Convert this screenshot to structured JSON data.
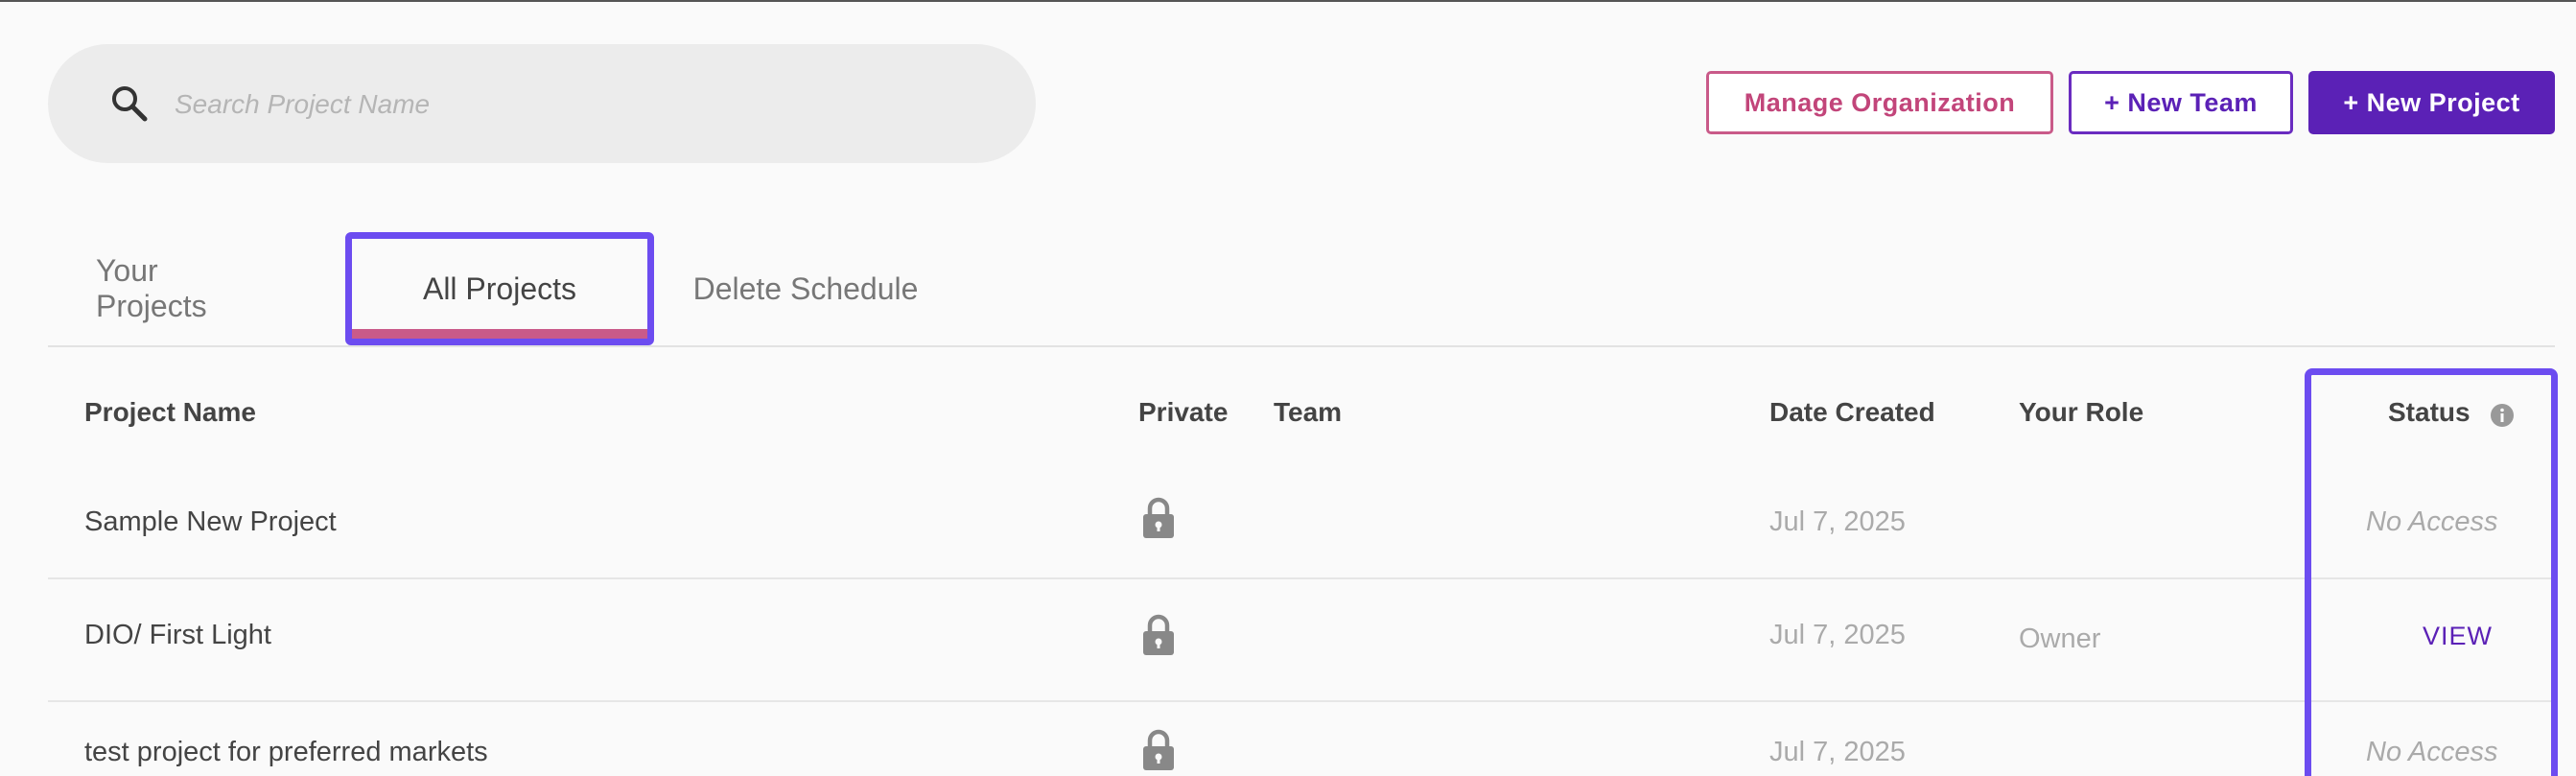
{
  "search": {
    "placeholder": "Search Project Name"
  },
  "toolbar": {
    "manage_label": "Manage Organization",
    "new_team_label": "+ New Team",
    "new_project_label": "+ New Project"
  },
  "tabs": [
    {
      "label": "Your Projects"
    },
    {
      "label": "All Projects"
    },
    {
      "label": "Delete Schedule"
    }
  ],
  "table": {
    "headers": {
      "name": "Project Name",
      "private": "Private",
      "team": "Team",
      "date": "Date Created",
      "role": "Your Role",
      "status": "Status"
    },
    "rows": [
      {
        "name": "Sample New Project",
        "private": true,
        "team": "",
        "date": "Jul 7, 2025",
        "role": "",
        "status": "No Access"
      },
      {
        "name": "DIO/ First Light",
        "private": true,
        "team": "",
        "date": "Jul 7, 2025",
        "role": "Owner",
        "status": "VIEW"
      },
      {
        "name": "test project for preferred markets",
        "private": true,
        "team": "",
        "date": "Jul 7, 2025",
        "role": "",
        "status": "No Access"
      }
    ]
  },
  "colors": {
    "accent_purple": "#5b21b6",
    "accent_pink": "#c95a89",
    "highlight": "#6c4cf0"
  },
  "icons": {
    "search": "search-icon",
    "lock": "lock-icon",
    "info": "info-icon"
  }
}
